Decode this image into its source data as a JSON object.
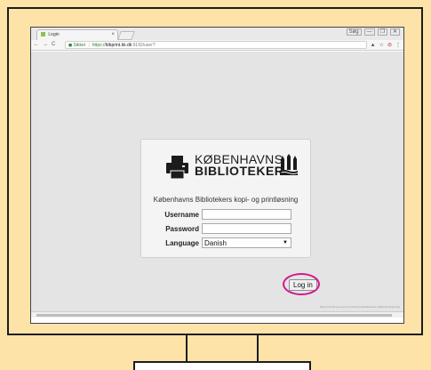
{
  "browser": {
    "tab_title": "Login",
    "tab_close": "×",
    "window_controls": [
      "Søg",
      "—",
      "❐",
      "✕"
    ],
    "nav_back": "←",
    "nav_forward": "→",
    "nav_reload": "C",
    "secure_label": "Sikker",
    "url_scheme": "https://",
    "url_host": "bibprint.kk.dk",
    "url_rest": ":9192/user?",
    "toolbar_icons": [
      "pin-icon",
      "star-icon",
      "block-icon",
      "menu-icon"
    ],
    "footer_note": "PaperCut MF licensed to Kobing Folkebiblioteker Bibliotek Brønshøj"
  },
  "login": {
    "logo_line1": "KØBENHAVNS",
    "logo_line2": "BIBLIOTEKER",
    "subtitle": "Københavns Bibliotekers kopi- og printløsning",
    "username_label": "Username",
    "password_label": "Password",
    "language_label": "Language",
    "language_value": "Danish",
    "username_value": "",
    "password_value": "",
    "login_button": "Log in"
  },
  "colors": {
    "background": "#fde3a8",
    "highlight": "#d0198e",
    "secure_green": "#2e7d32"
  }
}
